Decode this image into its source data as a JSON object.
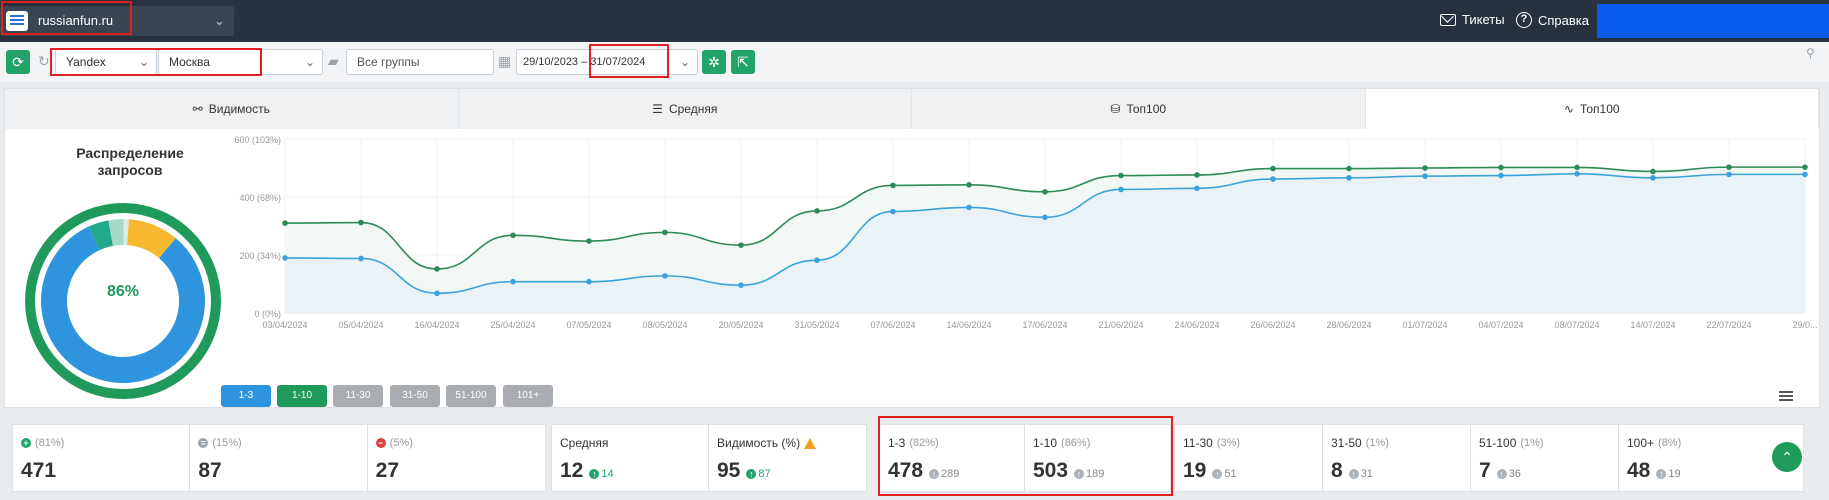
{
  "header": {
    "project": "russianfun.ru",
    "tickets_label": "Тикеты",
    "help_label": "Справка"
  },
  "filters": {
    "engine": "Yandex",
    "region": "Москва",
    "groups_placeholder": "Все группы",
    "date_range": "29/10/2023 – 31/07/2024"
  },
  "tabs": [
    {
      "label": "Видимость",
      "icon": "visibility-icon"
    },
    {
      "label": "Средняя",
      "icon": "average-icon"
    },
    {
      "label": "Топ100",
      "icon": "top100-icon"
    },
    {
      "label": "Топ100",
      "icon": "pulse-icon",
      "active": true
    }
  ],
  "distribution": {
    "title": "Распределение запросов",
    "center_label": "86%",
    "segments": [
      {
        "name": "1-3",
        "value": 82,
        "color": "#2f94de"
      },
      {
        "name": "4-10",
        "value": 4,
        "color": "#22a98a"
      },
      {
        "name": "11-30",
        "value": 3,
        "color": "#a8d8c8"
      },
      {
        "name": "31-50",
        "value": 1,
        "color": "#d7efe4"
      },
      {
        "name": "51-100",
        "value": 10,
        "color": "#f5b82e"
      }
    ],
    "outer_color": "#1f9a5a"
  },
  "chart_data": {
    "type": "line",
    "x": [
      "03/04/2024",
      "05/04/2024",
      "16/04/2024",
      "25/04/2024",
      "07/05/2024",
      "08/05/2024",
      "20/05/2024",
      "31/05/2024",
      "07/06/2024",
      "14/06/2024",
      "17/06/2024",
      "21/06/2024",
      "24/06/2024",
      "26/06/2024",
      "28/06/2024",
      "01/07/2024",
      "04/07/2024",
      "08/07/2024",
      "14/07/2024",
      "22/07/2024",
      "29/0..."
    ],
    "y_ticks": [
      "600 (103%)",
      "400 (68%)",
      "200 (34%)",
      "0 (0%)"
    ],
    "ylim": [
      0,
      600
    ],
    "grid": true,
    "series": [
      {
        "name": "1-10",
        "color": "#2e8b57",
        "values": [
          310,
          312,
          152,
          268,
          248,
          278,
          234,
          352,
          440,
          442,
          418,
          474,
          476,
          498,
          498,
          500,
          502,
          502,
          488,
          503,
          503
        ]
      },
      {
        "name": "1-3",
        "color": "#3ba3d9",
        "values": [
          190,
          188,
          68,
          108,
          108,
          128,
          96,
          182,
          350,
          364,
          330,
          426,
          430,
          462,
          466,
          472,
          474,
          480,
          466,
          478,
          478
        ]
      }
    ],
    "ranges": [
      {
        "label": "1-3",
        "color": "#2f94de"
      },
      {
        "label": "1-10",
        "color": "#1f9a5a"
      },
      {
        "label": "11-30",
        "color": "#a9adb2"
      },
      {
        "label": "31-50",
        "color": "#a9adb2"
      },
      {
        "label": "51-100",
        "color": "#a9adb2"
      },
      {
        "label": "101+",
        "color": "#a9adb2"
      }
    ]
  },
  "stats_group1": [
    {
      "pct": "(81%)",
      "value": "471",
      "icon": "plus-circle-icon",
      "icon_color": "#22a36a"
    },
    {
      "pct": "(15%)",
      "value": "87",
      "icon": "equal-circle-icon",
      "icon_color": "#9aa3ad"
    },
    {
      "pct": "(5%)",
      "value": "27",
      "icon": "minus-circle-icon",
      "icon_color": "#e04040"
    }
  ],
  "stats_group2": [
    {
      "label": "Средняя",
      "value": "12",
      "delta": "14"
    },
    {
      "label": "Видимость (%)",
      "value": "95",
      "delta": "87"
    }
  ],
  "stats_group3": [
    {
      "label": "1-3",
      "pct": "(82%)",
      "value": "478",
      "delta": "289"
    },
    {
      "label": "1-10",
      "pct": "(86%)",
      "value": "503",
      "delta": "189"
    }
  ],
  "stats_group4": [
    {
      "label": "11-30",
      "pct": "(3%)",
      "value": "19",
      "delta": "51"
    },
    {
      "label": "31-50",
      "pct": "(1%)",
      "value": "8",
      "delta": "31"
    },
    {
      "label": "51-100",
      "pct": "(1%)",
      "value": "7",
      "delta": "36"
    },
    {
      "label": "100+",
      "pct": "(8%)",
      "value": "48",
      "delta": "19"
    }
  ]
}
